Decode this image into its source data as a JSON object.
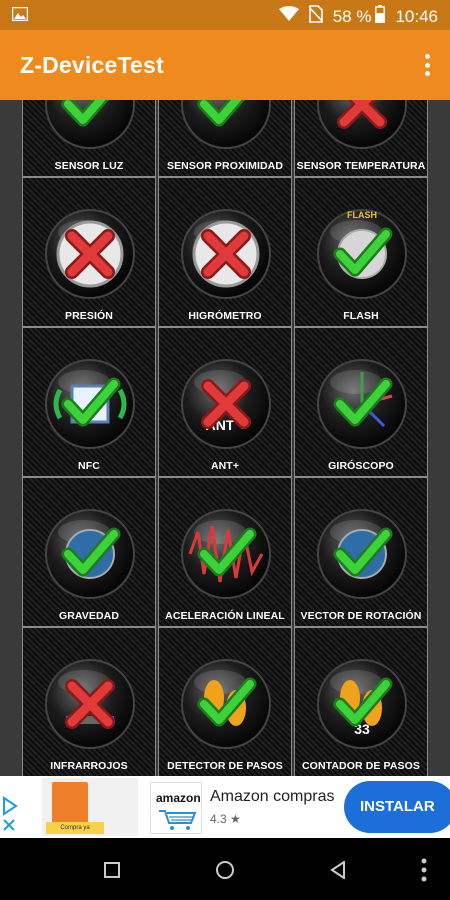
{
  "status_bar": {
    "battery": "58 %",
    "time": "10:46"
  },
  "app_bar": {
    "title": "Z-DeviceTest"
  },
  "tiles": [
    {
      "label": "SENSOR LUZ",
      "status": "pass"
    },
    {
      "label": "SENSOR PROXIMIDAD",
      "status": "pass"
    },
    {
      "label": "SENSOR TEMPERATURA",
      "status": "fail"
    },
    {
      "label": "PRESIÓN",
      "status": "fail"
    },
    {
      "label": "HIGRÓMETRO",
      "status": "fail"
    },
    {
      "label": "FLASH",
      "status": "pass",
      "badge": "FLASH"
    },
    {
      "label": "NFC",
      "status": "pass"
    },
    {
      "label": "ANT+",
      "status": "fail",
      "badge": "ANT +"
    },
    {
      "label": "GIRÓSCOPO",
      "status": "pass"
    },
    {
      "label": "GRAVEDAD",
      "status": "pass"
    },
    {
      "label": "ACELERACIÓN LINEAL",
      "status": "pass"
    },
    {
      "label": "VECTOR DE ROTACIÓN",
      "status": "pass"
    },
    {
      "label": "INFRARROJOS",
      "status": "fail"
    },
    {
      "label": "DETECTOR DE PASOS",
      "status": "pass"
    },
    {
      "label": "CONTADOR DE PASOS",
      "status": "pass",
      "badge": "33"
    }
  ],
  "ad": {
    "title": "Amazon compras",
    "rating": "4.3",
    "install_label": "INSTALAR",
    "logo_text": "amazon",
    "thumb_button": "Compra ya"
  },
  "colors": {
    "accent": "#ef8a1e",
    "status_bar": "#c97818",
    "install": "#1c6fd8",
    "pass": "#3dd13a",
    "fail": "#e03a3a"
  }
}
